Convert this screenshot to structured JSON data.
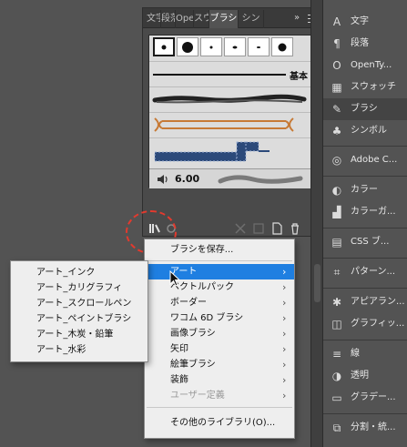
{
  "panel": {
    "tabs": [
      {
        "label": "文字"
      },
      {
        "label": "段落"
      },
      {
        "label": "Ope"
      },
      {
        "label": "スウ"
      },
      {
        "label": "ブラシ"
      },
      {
        "label": "シン"
      }
    ],
    "more_glyph": "»",
    "basic_label": "基本",
    "size_value": "6.00"
  },
  "dock": {
    "items": [
      {
        "label": "文字",
        "icon": "type-icon",
        "glyph": "A"
      },
      {
        "label": "段落",
        "icon": "paragraph-icon",
        "glyph": "¶"
      },
      {
        "label": "OpenTy...",
        "icon": "opentype-icon",
        "glyph": "O"
      },
      {
        "label": "スウォッチ",
        "icon": "swatches-icon",
        "glyph": "▦"
      },
      {
        "label": "ブラシ",
        "icon": "brush-icon",
        "glyph": "✎"
      },
      {
        "label": "シンボル",
        "icon": "symbol-icon",
        "glyph": "♣"
      },
      {
        "label": "Adobe C...",
        "icon": "adobe-color-icon",
        "glyph": "◎"
      },
      {
        "label": "カラー",
        "icon": "color-icon",
        "glyph": "◐"
      },
      {
        "label": "カラーガ...",
        "icon": "color-guide-icon",
        "glyph": "▟"
      },
      {
        "label": "CSS ブ...",
        "icon": "css-icon",
        "glyph": "▤"
      },
      {
        "label": "パターン...",
        "icon": "pattern-icon",
        "glyph": "⌗"
      },
      {
        "label": "アピアラン...",
        "icon": "appearance-icon",
        "glyph": "✱"
      },
      {
        "label": "グラフィッ...",
        "icon": "graphic-styles-icon",
        "glyph": "◫"
      },
      {
        "label": "線",
        "icon": "stroke-icon",
        "glyph": "≡"
      },
      {
        "label": "透明",
        "icon": "transparency-icon",
        "glyph": "◑"
      },
      {
        "label": "グラデー...",
        "icon": "gradient-icon",
        "glyph": "▭"
      },
      {
        "label": "分割・統...",
        "icon": "pathfinder-icon",
        "glyph": "⧉"
      }
    ]
  },
  "menu": {
    "save": "ブラシを保存...",
    "items": [
      {
        "label": "アート",
        "arrow": "›"
      },
      {
        "label": "ベクトルパック",
        "arrow": "›"
      },
      {
        "label": "ボーダー",
        "arrow": "›"
      },
      {
        "label": "ワコム 6D ブラシ",
        "arrow": "›"
      },
      {
        "label": "画像ブラシ",
        "arrow": "›"
      },
      {
        "label": "矢印",
        "arrow": "›"
      },
      {
        "label": "絵筆ブラシ",
        "arrow": "›"
      },
      {
        "label": "装飾",
        "arrow": "›"
      },
      {
        "label": "ユーザー定義",
        "arrow": "›"
      }
    ],
    "other": "その他のライブラリ(O)..."
  },
  "submenu": {
    "items": [
      "アート_インク",
      "アート_カリグラフィ",
      "アート_スクロールペン",
      "アート_ペイントブラシ",
      "アート_木炭・鉛筆",
      "アート_水彩"
    ]
  }
}
